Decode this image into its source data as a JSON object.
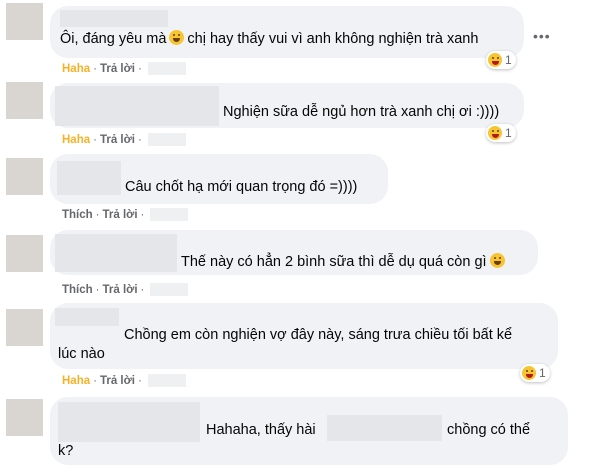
{
  "more_icon": "ellipsis-icon",
  "comments": [
    {
      "text": "Ôi, đáng yêu mà",
      "text_after": "chị hay thấy vui vì anh không nghiện trà xanh",
      "has_emoji": true,
      "action": "Haha",
      "reply": "Trả lời",
      "reactions": "1"
    },
    {
      "text": "Nghiện sữa dễ ngủ hơn trà xanh chị ơi :))))",
      "action": "Haha",
      "reply": "Trả lời",
      "reactions": "1"
    },
    {
      "text": "Câu chốt hạ mới quan trọng đó =))))",
      "action": "Thích",
      "reply": "Trả lời"
    },
    {
      "text": "Thế này có hẳn 2 bình sữa thì dễ dụ quá còn gì",
      "has_emoji": true,
      "action": "Thích",
      "reply": "Trả lời"
    },
    {
      "text": "Chồng em còn nghiện vợ đây này, sáng trưa chiều tối bất kể",
      "text_line2": "lúc nào",
      "action": "Haha",
      "reply": "Trả lời",
      "reactions": "1"
    },
    {
      "text": "Hahaha, thấy hài",
      "text_after": "chồng có thể",
      "text_line2": "k?"
    }
  ],
  "separator": "·"
}
